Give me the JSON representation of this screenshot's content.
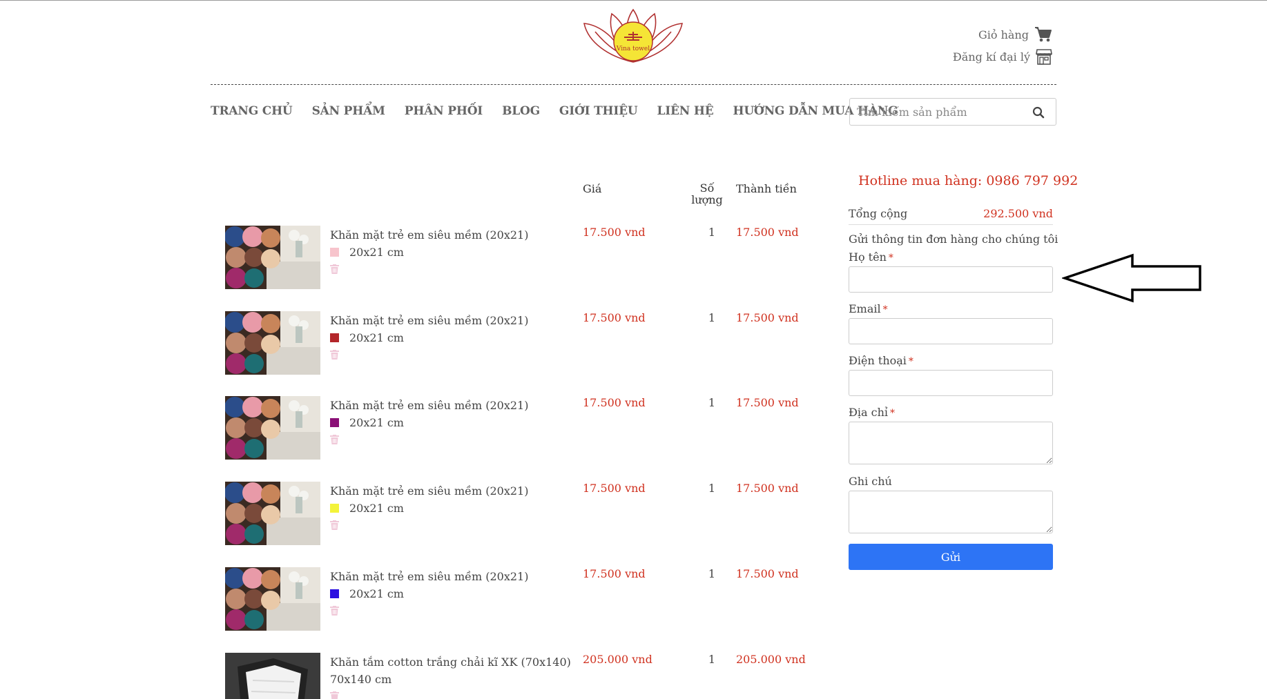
{
  "logo": {
    "text": "Vina towel"
  },
  "header": {
    "cart_label": "Giỏ hàng",
    "agent_label": "Đăng kí đại lý"
  },
  "nav": {
    "items": [
      "TRANG CHỦ",
      "SẢN PHẨM",
      "PHÂN PHỐI",
      "BLOG",
      "GIỚI THIỆU",
      "LIÊN HỆ",
      "HƯỚNG DẪN MUA HÀNG"
    ]
  },
  "search": {
    "placeholder": "Tìm kiếm sản phẩm"
  },
  "table": {
    "headers": {
      "price": "Giá",
      "qty_line1": "Số",
      "qty_line2": "lượng",
      "total": "Thành tiền"
    },
    "rows": [
      {
        "name": "Khăn mặt trẻ em siêu mềm (20x21)",
        "size": "20x21 cm",
        "color": "#f7c4cc",
        "price": "17.500 vnd",
        "qty": "1",
        "total": "17.500 vnd"
      },
      {
        "name": "Khăn mặt trẻ em siêu mềm (20x21)",
        "size": "20x21 cm",
        "color": "#b3262a",
        "price": "17.500 vnd",
        "qty": "1",
        "total": "17.500 vnd"
      },
      {
        "name": "Khăn mặt trẻ em siêu mềm (20x21)",
        "size": "20x21 cm",
        "color": "#8a1076",
        "price": "17.500 vnd",
        "qty": "1",
        "total": "17.500 vnd"
      },
      {
        "name": "Khăn mặt trẻ em siêu mềm (20x21)",
        "size": "20x21 cm",
        "color": "#f3f33a",
        "price": "17.500 vnd",
        "qty": "1",
        "total": "17.500 vnd"
      },
      {
        "name": "Khăn mặt trẻ em siêu mềm (20x21)",
        "size": "20x21 cm",
        "color": "#2b10e0",
        "price": "17.500 vnd",
        "qty": "1",
        "total": "17.500 vnd"
      },
      {
        "name": "Khăn tắm cotton trắng chải kĩ XK (70x140)",
        "size": "70x140 cm",
        "color": "",
        "price": "205.000 vnd",
        "qty": "1",
        "total": "205.000 vnd"
      }
    ]
  },
  "order": {
    "hotline": "Hotline mua hàng: 0986 797 992",
    "total_label": "Tổng cộng",
    "total_value": "292.500 vnd",
    "send_info": "Gửi thông tin đơn hàng cho chúng tôi",
    "fields": {
      "name": "Họ tên",
      "email": "Email",
      "phone": "Điện thoại",
      "address": "Địa chỉ",
      "note": "Ghi chú"
    },
    "required_mark": "*",
    "submit": "Gửi"
  },
  "colors": {
    "accent_red": "#d0311f",
    "button_blue": "#2d74f5"
  }
}
